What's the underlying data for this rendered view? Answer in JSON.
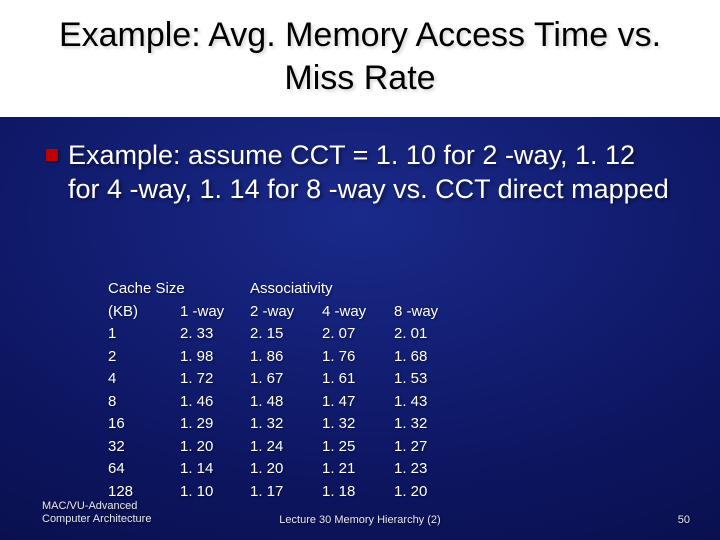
{
  "title": "Example: Avg. Memory Access Time vs. Miss Rate",
  "body": "Example: assume CCT = 1. 10 for 2 -way, 1. 12 for 4 -way, 1. 14 for 8 -way vs. CCT direct mapped",
  "table": {
    "h1a": "Cache Size",
    "h1b": "Associativity",
    "h2": {
      "c0": "(KB)",
      "c1": "1 -way",
      "c2": "2 -way",
      "c3": "4 -way",
      "c4": "8 -way"
    },
    "rows": [
      {
        "c0": "1",
        "c1": "2. 33",
        "c2": "2. 15",
        "c3": "2. 07",
        "c4": "2. 01"
      },
      {
        "c0": "2",
        "c1": "1. 98",
        "c2": "1. 86",
        "c3": "1. 76",
        "c4": "1. 68"
      },
      {
        "c0": "4",
        "c1": "1. 72",
        "c2": "1. 67",
        "c3": "1. 61",
        "c4": "1. 53"
      },
      {
        "c0": "8",
        "c1": "1. 46",
        "c2": "1. 48",
        "c3": "1. 47",
        "c4": "1. 43"
      },
      {
        "c0": "16",
        "c1": "1. 29",
        "c2": "1. 32",
        "c3": "1. 32",
        "c4": "1. 32"
      },
      {
        "c0": "32",
        "c1": "1. 20",
        "c2": "1. 24",
        "c3": "1. 25",
        "c4": "1. 27"
      },
      {
        "c0": "64",
        "c1": "1. 14",
        "c2": "1. 20",
        "c3": "1. 21",
        "c4": "1. 23"
      },
      {
        "c0": "128",
        "c1": "1. 10",
        "c2": "1. 17",
        "c3": "1. 18",
        "c4": "1. 20"
      }
    ]
  },
  "footer": {
    "left_line1": "MAC/VU-Advanced",
    "left_line2": "Computer Architecture",
    "center": "Lecture 30 Memory Hierarchy (2)",
    "page": "50"
  },
  "chart_data": {
    "type": "table",
    "title": "Avg. Memory Access Time vs. Miss Rate",
    "columns": [
      "Cache Size (KB)",
      "1-way",
      "2-way",
      "4-way",
      "8-way"
    ],
    "rows": [
      [
        1,
        2.33,
        2.15,
        2.07,
        2.01
      ],
      [
        2,
        1.98,
        1.86,
        1.76,
        1.68
      ],
      [
        4,
        1.72,
        1.67,
        1.61,
        1.53
      ],
      [
        8,
        1.46,
        1.48,
        1.47,
        1.43
      ],
      [
        16,
        1.29,
        1.32,
        1.32,
        1.32
      ],
      [
        32,
        1.2,
        1.24,
        1.25,
        1.27
      ],
      [
        64,
        1.14,
        1.2,
        1.21,
        1.23
      ],
      [
        128,
        1.1,
        1.17,
        1.18,
        1.2
      ]
    ]
  }
}
